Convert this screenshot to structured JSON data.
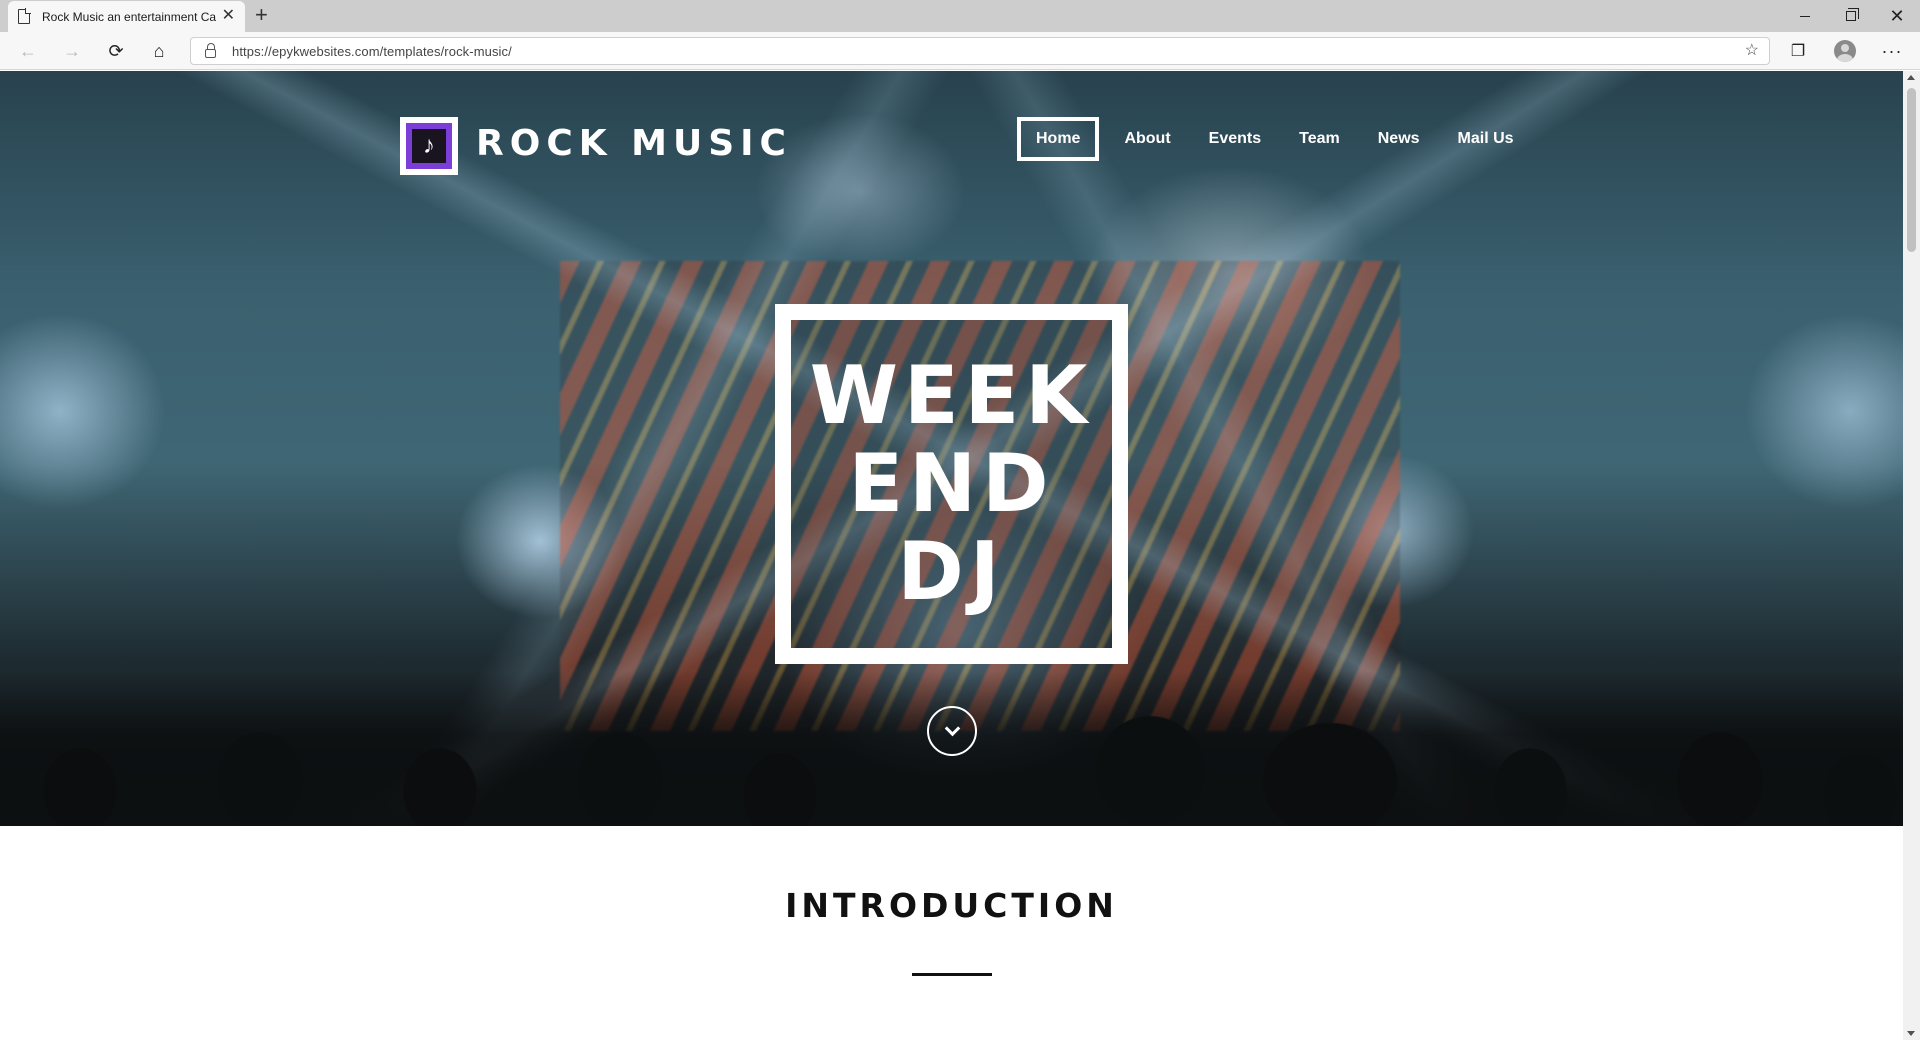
{
  "browser": {
    "tab_title": "Rock Music an entertainment Ca",
    "tab_close": "✕",
    "new_tab": "+",
    "url": "https://epykwebsites.com/templates/rock-music/",
    "window_controls": {
      "minimize": "",
      "maximize": "",
      "close": "✕"
    },
    "icons": {
      "back": "←",
      "forward": "→",
      "reload": "⟳",
      "home": "⌂",
      "favorites": "☆",
      "collections": "❐",
      "menu": "···"
    }
  },
  "site": {
    "logo_text": "ROCK MUSIC",
    "logo_glyph": "♪",
    "nav": [
      {
        "label": "Home",
        "active": true
      },
      {
        "label": "About"
      },
      {
        "label": "Events"
      },
      {
        "label": "Team"
      },
      {
        "label": "News"
      },
      {
        "label": "Mail Us"
      }
    ],
    "hero": {
      "lines": [
        "WEEK",
        "END",
        "DJ"
      ]
    },
    "intro_title": "INTRODUCTION"
  }
}
